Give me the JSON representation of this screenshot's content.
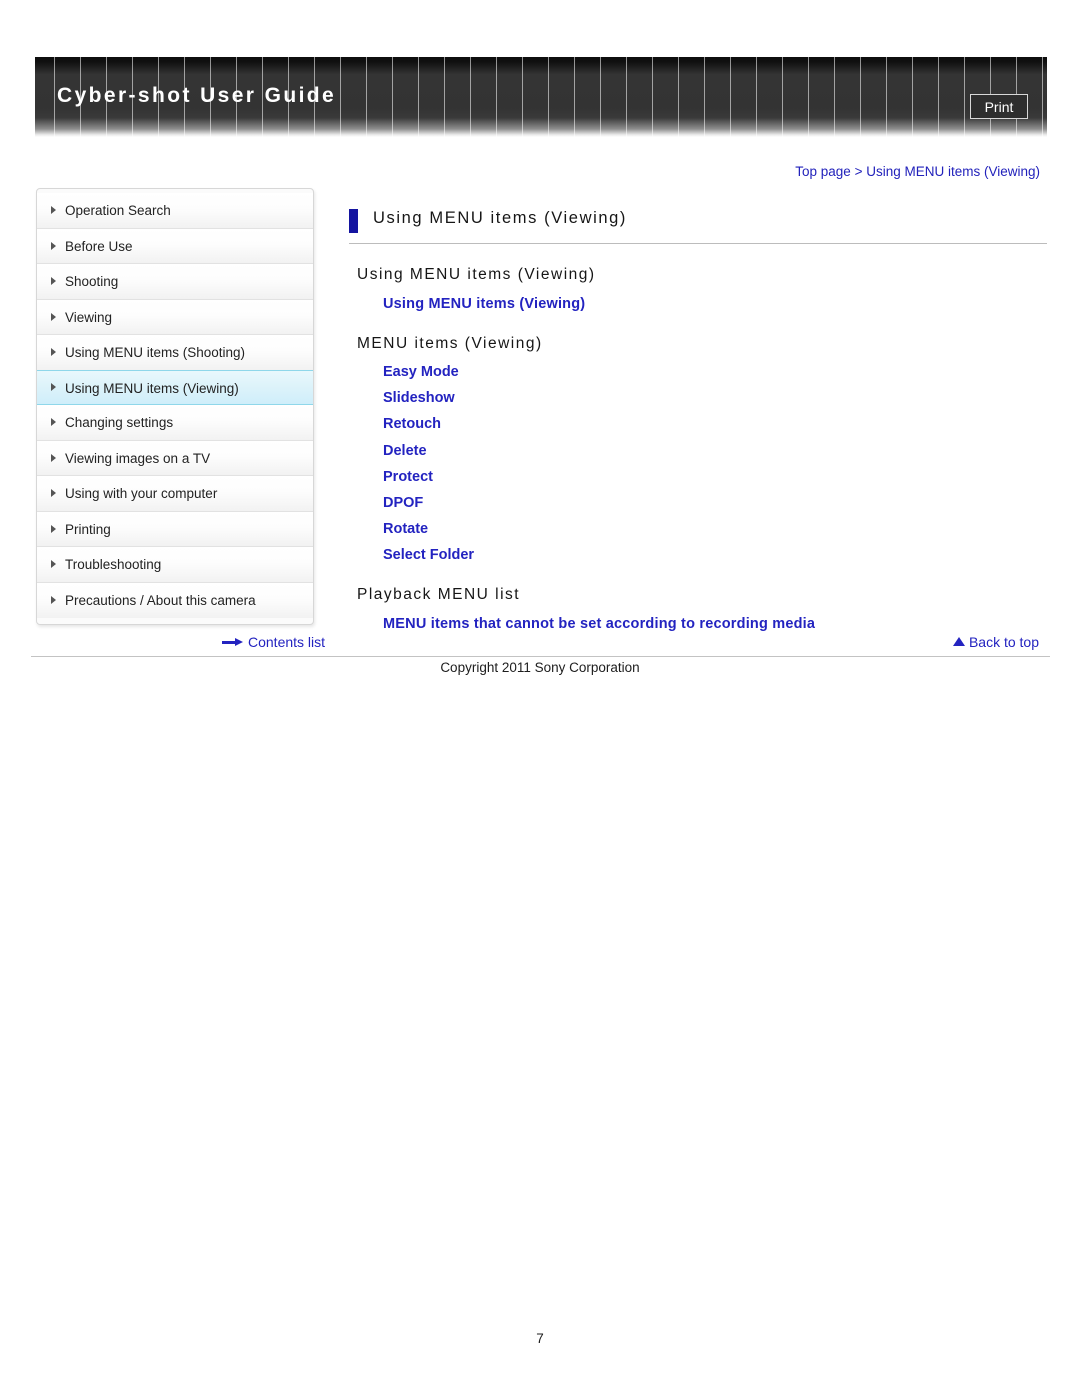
{
  "header": {
    "title": "Cyber-shot User Guide",
    "print_label": "Print"
  },
  "breadcrumb": {
    "text": "Top page > Using MENU items (Viewing)"
  },
  "sidebar": {
    "items": [
      {
        "label": "Operation Search",
        "selected": false
      },
      {
        "label": "Before Use",
        "selected": false
      },
      {
        "label": "Shooting",
        "selected": false
      },
      {
        "label": "Viewing",
        "selected": false
      },
      {
        "label": "Using MENU items (Shooting)",
        "selected": false
      },
      {
        "label": "Using MENU items (Viewing)",
        "selected": true
      },
      {
        "label": "Changing settings",
        "selected": false
      },
      {
        "label": "Viewing images on a TV",
        "selected": false
      },
      {
        "label": "Using with your computer",
        "selected": false
      },
      {
        "label": "Printing",
        "selected": false
      },
      {
        "label": "Troubleshooting",
        "selected": false
      },
      {
        "label": "Precautions / About this camera",
        "selected": false
      }
    ]
  },
  "main": {
    "page_title": "Using MENU items (Viewing)",
    "sections": [
      {
        "heading": "Using MENU items (Viewing)",
        "links": [
          "Using MENU items (Viewing)"
        ]
      },
      {
        "heading": "MENU items (Viewing)",
        "links": [
          "Easy Mode",
          "Slideshow",
          "Retouch",
          "Delete",
          "Protect",
          "DPOF",
          "Rotate",
          "Select Folder"
        ]
      },
      {
        "heading": "Playback MENU list",
        "links": [
          "MENU items that cannot be set according to recording media"
        ]
      }
    ]
  },
  "footer": {
    "contents_list": "Contents list",
    "back_to_top": "Back to top",
    "copyright": "Copyright 2011 Sony Corporation",
    "page_number": "7"
  },
  "colors": {
    "link": "#2323c0",
    "title_bar": "#1414a0",
    "selected_bg": "#d8f2fb",
    "selected_border": "#8fd7ea"
  }
}
